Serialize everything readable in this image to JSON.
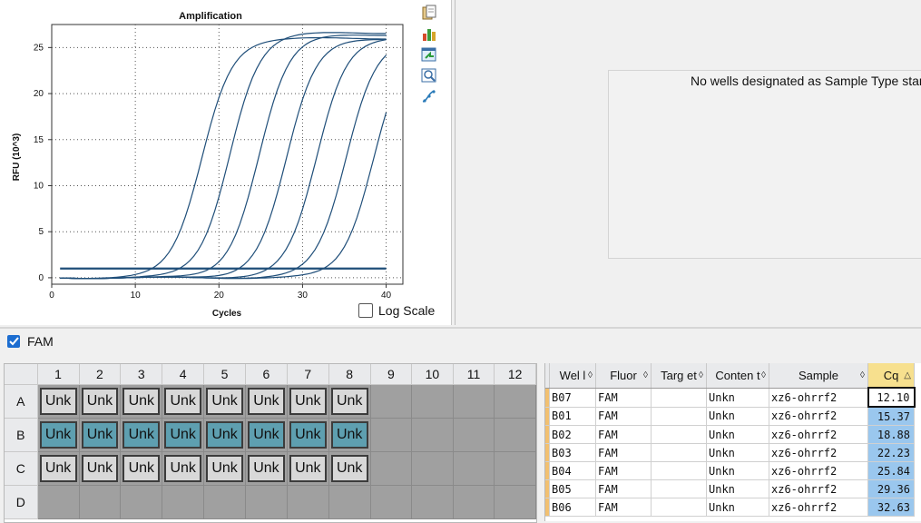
{
  "chart": {
    "toolbar_icons": [
      "copy-icon",
      "bar-chart-icon",
      "export-icon",
      "zoom-chart-icon",
      "curve-fit-icon"
    ],
    "log_scale_label": "Log Scale",
    "log_scale_checked": false
  },
  "chart_data": {
    "type": "line",
    "title": "Amplification",
    "xlabel": "Cycles",
    "ylabel": "RFU (10^3)",
    "xlim": [
      0,
      42
    ],
    "ylim": [
      -0.7,
      27.5
    ],
    "xticks": [
      0,
      10,
      20,
      30,
      40
    ],
    "yticks": [
      0,
      5,
      10,
      15,
      20,
      25
    ],
    "threshold": 1.0,
    "grid": true,
    "line_color": "#1f4e79",
    "series": [
      {
        "cq": 12.1,
        "plateau": 26.0
      },
      {
        "cq": 15.37,
        "plateau": 26.6
      },
      {
        "cq": 18.88,
        "plateau": 26.4
      },
      {
        "cq": 22.23,
        "plateau": 26.0
      },
      {
        "cq": 25.84,
        "plateau": 26.2
      },
      {
        "cq": 29.36,
        "plateau": 26.0
      },
      {
        "cq": 32.63,
        "plateau": 25.8
      }
    ]
  },
  "right_panel": {
    "message": "No wells designated as Sample Type standard"
  },
  "fluor_filter": {
    "label": "FAM",
    "checked": true
  },
  "plate": {
    "columns": [
      "1",
      "2",
      "3",
      "4",
      "5",
      "6",
      "7",
      "8",
      "9",
      "10",
      "11",
      "12"
    ],
    "rows": [
      {
        "label": "A",
        "wells": [
          "Unk",
          "Unk",
          "Unk",
          "Unk",
          "Unk",
          "Unk",
          "Unk",
          "Unk",
          "",
          "",
          "",
          ""
        ],
        "selected": false
      },
      {
        "label": "B",
        "wells": [
          "Unk",
          "Unk",
          "Unk",
          "Unk",
          "Unk",
          "Unk",
          "Unk",
          "Unk",
          "",
          "",
          "",
          ""
        ],
        "selected": true
      },
      {
        "label": "C",
        "wells": [
          "Unk",
          "Unk",
          "Unk",
          "Unk",
          "Unk",
          "Unk",
          "Unk",
          "Unk",
          "",
          "",
          "",
          ""
        ],
        "selected": false
      },
      {
        "label": "D",
        "wells": [
          "",
          "",
          "",
          "",
          "",
          "",
          "",
          "",
          "",
          "",
          "",
          ""
        ],
        "selected": false
      }
    ]
  },
  "results": {
    "headers": [
      "Wel l",
      "Fluor",
      "Targ et",
      "Conten t",
      "Sample",
      "Cq"
    ],
    "rows": [
      {
        "well": "B07",
        "fluor": "FAM",
        "target": "",
        "content": "Unkn",
        "sample": "xz6-ohrrf2",
        "cq": "12.10"
      },
      {
        "well": "B01",
        "fluor": "FAM",
        "target": "",
        "content": "Unkn",
        "sample": "xz6-ohrrf2",
        "cq": "15.37"
      },
      {
        "well": "B02",
        "fluor": "FAM",
        "target": "",
        "content": "Unkn",
        "sample": "xz6-ohrrf2",
        "cq": "18.88"
      },
      {
        "well": "B03",
        "fluor": "FAM",
        "target": "",
        "content": "Unkn",
        "sample": "xz6-ohrrf2",
        "cq": "22.23"
      },
      {
        "well": "B04",
        "fluor": "FAM",
        "target": "",
        "content": "Unkn",
        "sample": "xz6-ohrrf2",
        "cq": "25.84"
      },
      {
        "well": "B05",
        "fluor": "FAM",
        "target": "",
        "content": "Unkn",
        "sample": "xz6-ohrrf2",
        "cq": "29.36"
      },
      {
        "well": "B06",
        "fluor": "FAM",
        "target": "",
        "content": "Unkn",
        "sample": "xz6-ohrrf2",
        "cq": "32.63"
      }
    ]
  }
}
